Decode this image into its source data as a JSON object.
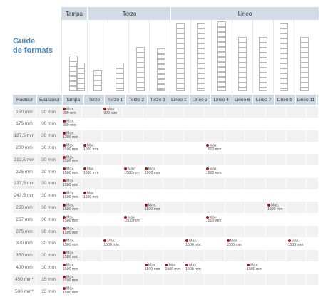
{
  "title": [
    "Guide",
    "de formats"
  ],
  "groups": [
    "Tampa",
    "Terzo",
    "Lineo"
  ],
  "columns": [
    "Hauteur",
    "Épaisseur",
    "Tampa",
    "Terzo",
    "Terzo 1",
    "Terzo 2",
    "Terzo 3",
    "Lineo 1",
    "Lineo 3",
    "Lineo 4",
    "Lineo 6",
    "Lineo 7",
    "Lineo 9",
    "Lineo 11"
  ],
  "rows": [
    {
      "h": "150 mm",
      "e": "30 mm",
      "cells": {
        "0": [
          "Max.",
          "900 mm"
        ],
        "2": [
          "Max.",
          "900 mm"
        ]
      }
    },
    {
      "h": "175 mm",
      "e": "30 mm",
      "cells": {
        "0": [
          "Max.",
          "900 mm"
        ]
      }
    },
    {
      "h": "187,5 mm",
      "e": "30 mm",
      "cells": {
        "0": [
          "Max.",
          "1200 mm"
        ]
      }
    },
    {
      "h": "200 mm",
      "e": "30 mm",
      "cells": {
        "0": [
          "Max.",
          "1500 mm"
        ],
        "1": [
          "Max.",
          "1500 mm"
        ],
        "7": [
          "Max.",
          "1500 mm"
        ]
      }
    },
    {
      "h": "212,5 mm",
      "e": "30 mm",
      "cells": {
        "0": [
          "Max.",
          "1500 mm"
        ]
      }
    },
    {
      "h": "225 mm",
      "e": "30 mm",
      "cells": {
        "0": [
          "Max.",
          "1500 mm"
        ],
        "1": [
          "Max.",
          "1500 mm"
        ],
        "3": [
          "Max.",
          "1500 mm"
        ],
        "4": [
          "Max.",
          "1500 mm"
        ],
        "7": [
          "Max.",
          "1500 mm"
        ]
      }
    },
    {
      "h": "237,5 mm",
      "e": "30 mm",
      "cells": {
        "0": [
          "Max.",
          "1500 mm"
        ]
      }
    },
    {
      "h": "243,5 mm",
      "e": "30 mm",
      "cells": {
        "0": [
          "Max.",
          "1500 mm"
        ],
        "1": [
          "Max.",
          "1500 mm"
        ]
      }
    },
    {
      "h": "250 mm",
      "e": "30 mm",
      "cells": {
        "0": [
          "Max.",
          "1500 mm"
        ],
        "4": [
          "Max.",
          "1500 mm"
        ],
        "10": [
          "Max.",
          "1500 mm"
        ]
      }
    },
    {
      "h": "257 mm",
      "e": "30 mm",
      "cells": {
        "0": [
          "Max.",
          "1500 mm"
        ],
        "3": [
          "Max.",
          "1500 mm"
        ],
        "7": [
          "Max.",
          "1500 mm"
        ]
      }
    },
    {
      "h": "275 mm",
      "e": "30 mm",
      "cells": {
        "0": [
          "Max.",
          "1500 mm"
        ]
      }
    },
    {
      "h": "300 mm",
      "e": "30 mm",
      "cells": {
        "0": [
          "Max.",
          "1500 mm"
        ],
        "2": [
          "Max.",
          "1500 mm"
        ],
        "6": [
          "Max.",
          "1500 mm"
        ],
        "8": [
          "Max.",
          "1500 mm"
        ],
        "11": [
          "Max.",
          "1500 mm"
        ]
      }
    },
    {
      "h": "350 mm",
      "e": "30 mm",
      "cells": {
        "0": [
          "Max.",
          "1500 mm"
        ]
      }
    },
    {
      "h": "400 mm",
      "e": "30 mm",
      "cells": {
        "0": [
          "Max.",
          "1500 mm"
        ],
        "4": [
          "Max.",
          "1500 mm"
        ],
        "5": [
          "Max.",
          "1500 mm"
        ],
        "6": [
          "Max.",
          "1500 mm"
        ],
        "9": [
          "Max.",
          "1500 mm"
        ]
      }
    },
    {
      "h": "450 mm*",
      "e": "35 mm",
      "cells": {
        "0": [
          "Max.",
          "1500 mm"
        ]
      }
    },
    {
      "h": "500 mm*",
      "e": "35 mm",
      "cells": {
        "0": [
          "Max.",
          "1500 mm"
        ]
      }
    }
  ],
  "colors": {
    "title": "#4a8ec6",
    "header": "#cfd9e4",
    "group": "#d3dce6",
    "dot": "#9b1b1b"
  }
}
